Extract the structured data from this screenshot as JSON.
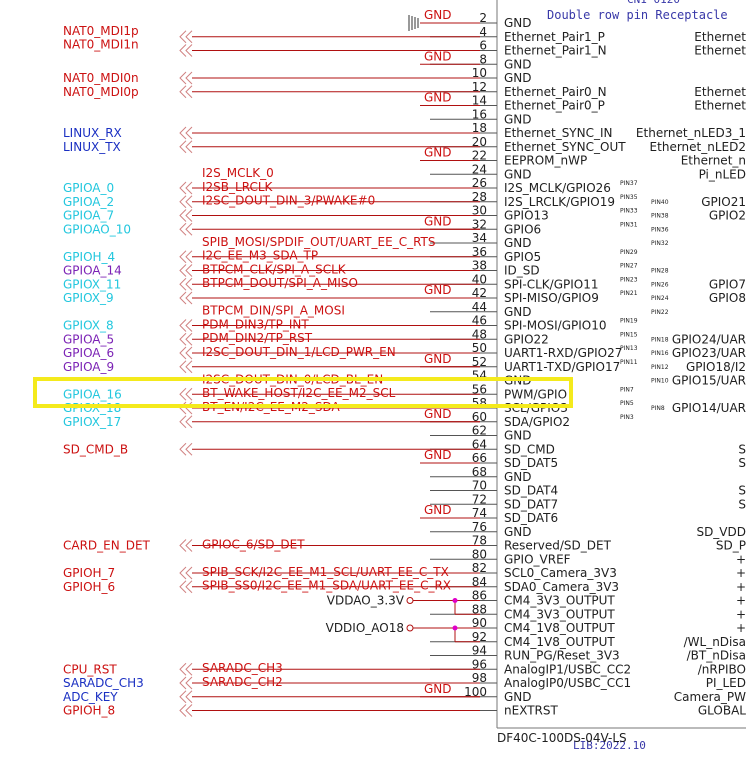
{
  "header": {
    "partial_label": "CN1 0120",
    "title": "Double row pin Receptacle",
    "lib": "LIB:2022.10",
    "part_number": "DF40C-100DS-04V-LS"
  },
  "colors": {
    "net_red": "#cc1111",
    "net_cyan": "#22c7de",
    "net_purple": "#7b22b5",
    "net_blue": "#1a2fc2",
    "wire": "#b01010",
    "text": "#202020",
    "label_blue": "#3838a8",
    "highlight": "#f4ea1c",
    "junction": "#e000c8"
  },
  "connector_pins": [
    {
      "n": "2",
      "pin": "GND",
      "right": "",
      "gnd": "GND",
      "chassis": true
    },
    {
      "n": "4",
      "pin": "Ethernet_Pair1_P",
      "right": "Ethernet"
    },
    {
      "n": "6",
      "pin": "Ethernet_Pair1_N",
      "right": "Ethernet"
    },
    {
      "n": "8",
      "pin": "GND",
      "gnd": "GND"
    },
    {
      "n": "10",
      "pin": "GND",
      "left": "NAT0_MDI0n",
      "lc": "net_red"
    },
    {
      "n": "12",
      "pin": "Ethernet_Pair0_N",
      "right": "Ethernet",
      "left": "NAT0_MDI0p",
      "lc": "net_red"
    },
    {
      "n": "14",
      "pin": "Ethernet_Pair0_P",
      "right": "Ethernet",
      "gnd": "GND"
    },
    {
      "n": "16",
      "pin": "GND"
    },
    {
      "n": "18",
      "pin": "Ethernet_SYNC_IN",
      "right": "Ethernet_nLED3_1",
      "left": "LINUX_RX",
      "lc": "net_blue"
    },
    {
      "n": "20",
      "pin": "Ethernet_SYNC_OUT",
      "right": "Ethernet_nLED2",
      "left": "LINUX_TX",
      "lc": "net_blue"
    },
    {
      "n": "22",
      "pin": "EEPROM_nWP",
      "right": "Ethernet_n",
      "gnd": "GND"
    },
    {
      "n": "24",
      "pin": "GND",
      "right": "Pi_nLED",
      "wl": "I2S_MCLK_0"
    },
    {
      "n": "26",
      "pin": "I2S_MCLK/GPIO26",
      "right": "",
      "rp": "PIN37",
      "wl": "I2SB_LRCLK",
      "left": "GPIOA_0",
      "lc": "net_cyan"
    },
    {
      "n": "28",
      "pin": "I2S_LRCLK/GPIO19",
      "rp": "PIN35",
      "rp2": "PIN40",
      "right": "GPIO21",
      "wl": "I2SC_DOUT_DIN_3/PWAKE#0",
      "left": "GPIOA_2",
      "lc": "net_cyan"
    },
    {
      "n": "30",
      "pin": "GPIO13",
      "rp": "PIN33",
      "rp2": "PIN38",
      "right": "GPIO2",
      "left": "GPIOA_7",
      "lc": "net_cyan"
    },
    {
      "n": "32",
      "pin": "GPIO6",
      "rp": "PIN31",
      "rp2": "PIN36",
      "right": "",
      "gnd": "GND",
      "left": "GPIOAO_10",
      "lc": "net_cyan"
    },
    {
      "n": "34",
      "pin": "GND",
      "rp2": "PIN32",
      "wl": "SPIB_MOSI/SPDIF_OUT/UART_EE_C_RTS"
    },
    {
      "n": "36",
      "pin": "GPIO5",
      "rp": "PIN29",
      "wl": "I2C_EE_M3_SDA_TP",
      "left": "GPIOH_4",
      "lc": "net_cyan"
    },
    {
      "n": "38",
      "pin": "ID_SD",
      "rp": "PIN27",
      "rp2": "PIN28",
      "wl": "BTPCM_CLK/SPI_A_SCLK",
      "left": "GPIOA_14",
      "lc": "net_purple"
    },
    {
      "n": "40",
      "pin": "SPI-CLK/GPIO11",
      "rp": "PIN23",
      "rp2": "PIN26",
      "right": "GPIO7",
      "wl": "BTPCM_DOUT/SPI_A_MISO",
      "left": "GPIOX_11",
      "lc": "net_cyan"
    },
    {
      "n": "42",
      "pin": "SPI-MISO/GPIO9",
      "rp": "PIN21",
      "rp2": "PIN24",
      "right": "GPIO8",
      "gnd": "GND",
      "left": "GPIOX_9",
      "lc": "net_cyan"
    },
    {
      "n": "44",
      "pin": "GND",
      "rp2": "PIN22",
      "wl": "BTPCM_DIN/SPI_A_MOSI"
    },
    {
      "n": "46",
      "pin": "SPI-MOSI/GPIO10",
      "rp": "PIN19",
      "wl": "PDM_DIN3/TP_INT",
      "left": "GPIOX_8",
      "lc": "net_cyan"
    },
    {
      "n": "48",
      "pin": "GPIO22",
      "rp": "PIN15",
      "rp2": "PIN18",
      "right": "GPIO24/UAR",
      "wl": "PDM_DIN2/TP_RST",
      "left": "GPIOA_5",
      "lc": "net_purple"
    },
    {
      "n": "50",
      "pin": "UART1-RXD/GPIO27",
      "rp": "PIN13",
      "rp2": "PIN16",
      "right": "GPIO23/UAR",
      "wl": "I2SC_DOUT_DIN_1/LCD_PWR_EN",
      "left": "GPIOA_6",
      "lc": "net_purple"
    },
    {
      "n": "52",
      "pin": "UART1-TXD/GPIO17",
      "rp": "PIN11",
      "rp2": "PIN12",
      "right": "GPIO18/I2",
      "gnd": "GND",
      "left": "GPIOA_9",
      "lc": "net_purple"
    },
    {
      "n": "54",
      "pin": "GND",
      "rp2": "PIN10",
      "right": "GPIO15/UAR",
      "wl": "I2SC_DOUT_DIN_0/LCD_BL_EN"
    },
    {
      "n": "56",
      "pin": "PWM/GPIO",
      "rp": "PIN7",
      "wl": "BT_WAKE_HOST/I2C_EE_M2_SCL",
      "left": "GPIOA_16",
      "lc": "net_cyan"
    },
    {
      "n": "58",
      "pin": "SCL/GPIO3",
      "rp": "PIN5",
      "rp2": "PIN8",
      "right": "GPIO14/UAR",
      "wl": "BT_EN/I2C_EE_M2_SDA",
      "left": "GPIOX_18",
      "lc": "net_cyan"
    },
    {
      "n": "60",
      "pin": "SDA/GPIO2",
      "rp": "PIN3",
      "gnd": "GND",
      "left": "GPIOX_17",
      "lc": "net_cyan"
    },
    {
      "n": "62",
      "pin": "GND"
    },
    {
      "n": "64",
      "pin": "SD_CMD",
      "right": "S",
      "left": "SD_CMD_B",
      "lc": "net_red"
    },
    {
      "n": "66",
      "pin": "SD_DAT5",
      "right": "S",
      "gnd": "GND"
    },
    {
      "n": "68",
      "pin": "GND"
    },
    {
      "n": "70",
      "pin": "SD_DAT4",
      "right": "S"
    },
    {
      "n": "72",
      "pin": "SD_DAT7",
      "right": "S"
    },
    {
      "n": "74",
      "pin": "SD_DAT6",
      "gnd": "GND"
    },
    {
      "n": "76",
      "pin": "GND",
      "right": "SD_VDD"
    },
    {
      "n": "78",
      "pin": "Reserved/SD_DET",
      "right": "SD_P",
      "wl": "GPIOC_6/SD_DET",
      "left": "CARD_EN_DET",
      "lc": "net_red"
    },
    {
      "n": "80",
      "pin": "GPIO_VREF",
      "right": "+"
    },
    {
      "n": "82",
      "pin": "SCL0_Camera_3V3",
      "right": "+",
      "wl": "SPIB_SCK/I2C_EE_M1_SCL/UART_EE_C_TX",
      "left": "GPIOH_7",
      "lc": "net_red"
    },
    {
      "n": "84",
      "pin": "SDA0_Camera_3V3",
      "right": "+",
      "wl": "SPIB_SS0/I2C_EE_M1_SDA/UART_EE_C_RX",
      "left": "GPIOH_6",
      "lc": "net_red"
    },
    {
      "n": "86",
      "pin": "CM4_3V3_OUTPUT",
      "right": "+"
    },
    {
      "n": "88",
      "pin": "CM4_3V3_OUTPUT",
      "right": "+"
    },
    {
      "n": "90",
      "pin": "CM4_1V8_OUTPUT",
      "right": "+"
    },
    {
      "n": "92",
      "pin": "CM4_1V8_OUTPUT",
      "right": "/WL_nDisa"
    },
    {
      "n": "94",
      "pin": "RUN_PG/Reset_3V3",
      "right": "/BT_nDisa"
    },
    {
      "n": "96",
      "pin": "AnalogIP1/USBC_CC2",
      "right": "/nRPIBO",
      "wl": "SARADC_CH3",
      "left": "CPU_RST",
      "lc": "net_red"
    },
    {
      "n": "98",
      "pin": "AnalogIP0/USBC_CC1",
      "right": "PI_LED",
      "wl": "SARADC_CH2",
      "left": "SARADC_CH3",
      "lc": "net_blue"
    },
    {
      "n": "100",
      "pin": "GND",
      "right": "Camera_PW",
      "gnd": "GND",
      "left": "ADC_KEY",
      "lc": "net_blue"
    },
    {
      "n": "",
      "pin": "nEXTRST",
      "right": "GLOBAL",
      "left": "GPIOH_8",
      "lc": "net_red"
    }
  ],
  "extra_nets": [
    {
      "label": "NAT0_MDI1p",
      "color": "net_red",
      "pin": "4"
    },
    {
      "label": "NAT0_MDI1n",
      "color": "net_red",
      "pin": "6"
    }
  ],
  "power_nets": [
    {
      "label": "VDDAO_3.3V",
      "pins": [
        "86",
        "88"
      ]
    },
    {
      "label": "VDDIO_AO18",
      "pins": [
        "90",
        "92"
      ]
    }
  ]
}
